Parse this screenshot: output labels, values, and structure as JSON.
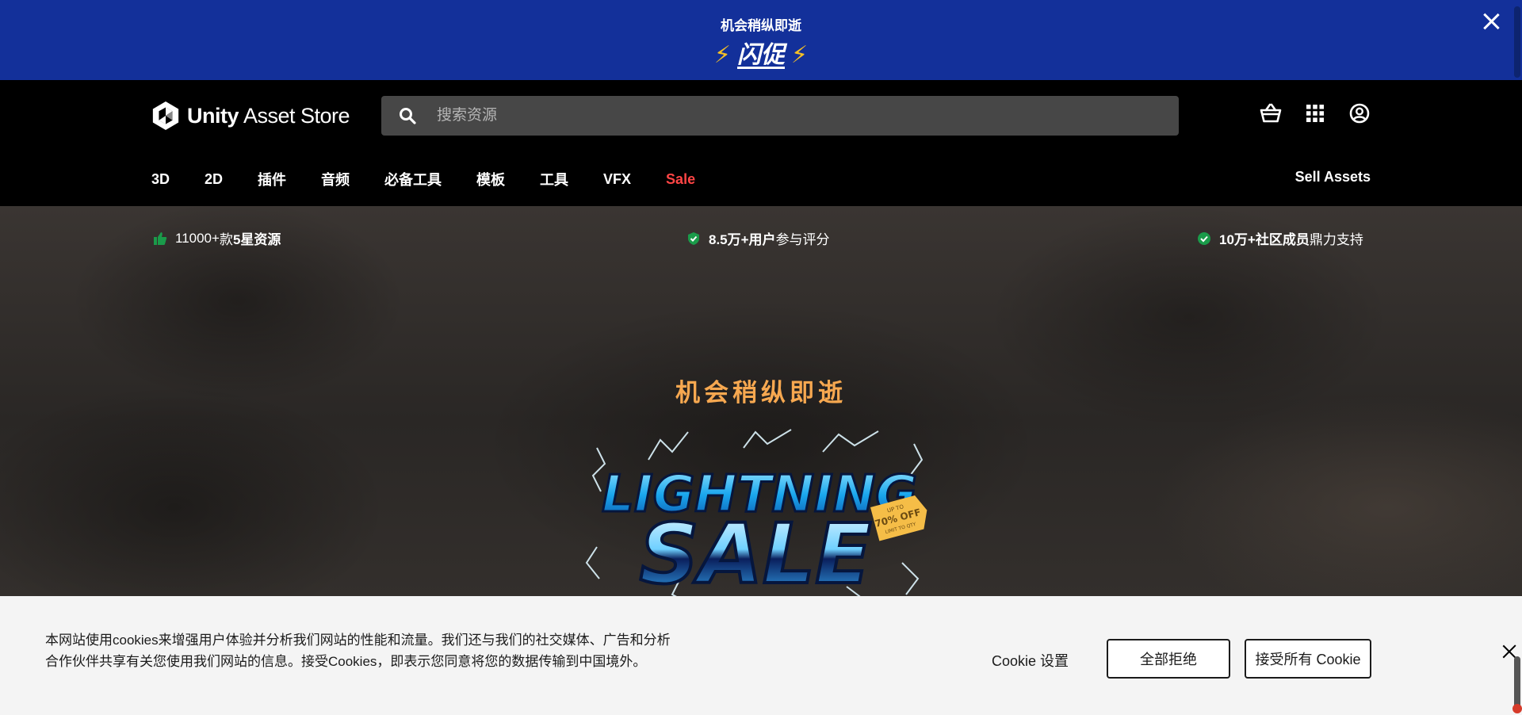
{
  "promo": {
    "subtitle": "机会稍纵即逝",
    "headline": "闪促",
    "bolt_left": "⚡",
    "bolt_right": "⚡"
  },
  "header": {
    "brand_bold": "Unity",
    "brand_rest": "Asset Store",
    "search_placeholder": "搜索资源",
    "icons": [
      "cart-icon",
      "apps-grid-icon",
      "account-icon"
    ]
  },
  "nav": {
    "items": [
      "3D",
      "2D",
      "插件",
      "音频",
      "必备工具",
      "模板",
      "工具",
      "VFX",
      "Sale"
    ],
    "sell_label": "Sell Assets"
  },
  "trust": {
    "t1_num": "11000+",
    "t1_mid": "款",
    "t1_bold": "5星资源",
    "t2_bold": "8.5万+用户",
    "t2_rest": "参与评分",
    "t3_bold": "10万+社区成员",
    "t3_rest": "鼎力支持"
  },
  "hero": {
    "title": "机会稍纵即逝",
    "art_line1": "LIGHTNING",
    "art_line2": "SALE",
    "tag_top": "UP TO",
    "tag_main": "70% OFF",
    "tag_bottom": "LIMIT TO QTY"
  },
  "cookie": {
    "message": "本网站使用cookies来增强用户体验并分析我们网站的性能和流量。我们还与我们的社交媒体、广告和分析合作伙伴共享有关您使用我们网站的信息。接受Cookies，即表示您同意将您的数据传输到中国境外。",
    "settings_label": "Cookie 设置",
    "reject_label": "全部拒绝",
    "accept_label": "接受所有 Cookie"
  },
  "colors": {
    "promo_bg": "#13309a",
    "header_bg": "#000000",
    "sale": "#ff4545",
    "hero_title": "#f7a850",
    "trust_icon": "#1a9b4a"
  }
}
